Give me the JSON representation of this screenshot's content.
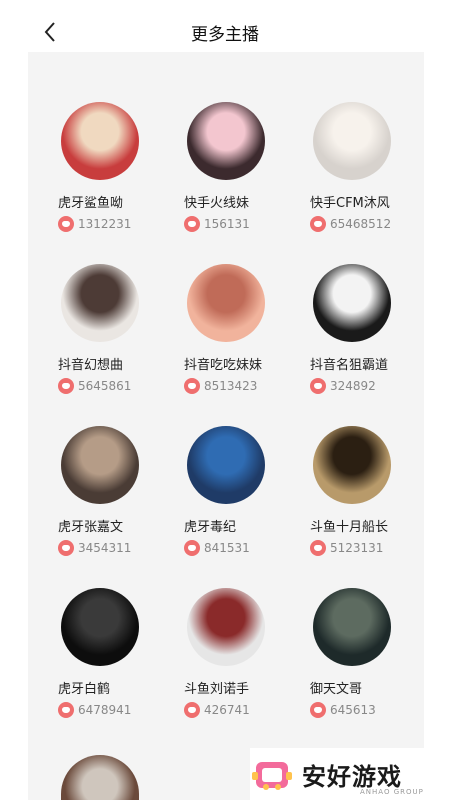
{
  "header": {
    "title": "更多主播"
  },
  "streamers": [
    {
      "name": "虎牙鲨鱼呦",
      "fans": "1312231",
      "colors": [
        "#c83d3d",
        "#f0d9c0"
      ]
    },
    {
      "name": "快手火线妹",
      "fans": "156131",
      "colors": [
        "#3c2a2e",
        "#f3c6cf"
      ]
    },
    {
      "name": "快手CFM沐风",
      "fans": "65468512",
      "colors": [
        "#d7d2cd",
        "#f7f2ec"
      ]
    },
    {
      "name": "抖音幻想曲",
      "fans": "5645861",
      "colors": [
        "#eae6e2",
        "#4d3b36"
      ]
    },
    {
      "name": "抖音吃吃妹妹",
      "fans": "8513423",
      "colors": [
        "#f1b39c",
        "#c06b58"
      ]
    },
    {
      "name": "抖音名狙霸道",
      "fans": "324892",
      "colors": [
        "#1a1a1a",
        "#f3f3f3"
      ]
    },
    {
      "name": "虎牙张嘉文",
      "fans": "3454311",
      "colors": [
        "#4a3c35",
        "#b59c87"
      ]
    },
    {
      "name": "虎牙毒纪",
      "fans": "841531",
      "colors": [
        "#1f3b67",
        "#2f6cb3"
      ]
    },
    {
      "name": "斗鱼十月船长",
      "fans": "5123131",
      "colors": [
        "#b89a6a",
        "#2b1f12"
      ]
    },
    {
      "name": "虎牙白鹤",
      "fans": "6478941",
      "colors": [
        "#0d0d0d",
        "#3a3a3a"
      ]
    },
    {
      "name": "斗鱼刘诺手",
      "fans": "426741",
      "colors": [
        "#e6e6e6",
        "#8a2a2a"
      ]
    },
    {
      "name": "御天文哥",
      "fans": "645613",
      "colors": [
        "#1e2a2a",
        "#5d6b60"
      ]
    }
  ],
  "partial_avatar_colors": [
    "#cfc6bd",
    "#6b4a3b"
  ],
  "watermark": {
    "text": "安好游戏",
    "sub": "ANHAO GROUP"
  }
}
